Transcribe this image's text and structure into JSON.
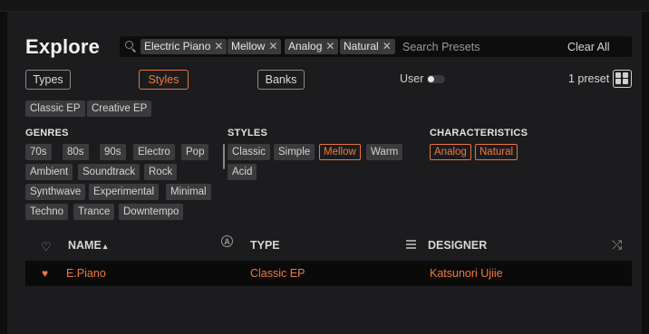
{
  "header": {
    "title": "Explore"
  },
  "search": {
    "chips": [
      {
        "label": "Electric Piano"
      },
      {
        "label": "Mellow"
      },
      {
        "label": "Analog"
      },
      {
        "label": "Natural"
      }
    ],
    "placeholder": "Search Presets",
    "clear_label": "Clear All",
    "remove_glyph": "✕"
  },
  "filters": {
    "tabs": [
      {
        "label": "Types",
        "active": false
      },
      {
        "label": "Styles",
        "active": true
      },
      {
        "label": "Banks",
        "active": false
      }
    ],
    "user_label": "User",
    "user_toggle_on": false,
    "preset_count": "1 preset"
  },
  "type_tags": [
    "Classic EP",
    "Creative EP"
  ],
  "genres": {
    "heading": "GENRES",
    "tags": [
      "70s",
      "80s",
      "90s",
      "Electro",
      "Pop",
      "Ambient",
      "Soundtrack",
      "Rock",
      "Synthwave",
      "Experimental",
      "Minimal",
      "Techno",
      "Trance",
      "Downtempo"
    ]
  },
  "styles": {
    "heading": "STYLES",
    "tags": [
      {
        "label": "Classic",
        "selected": false
      },
      {
        "label": "Simple",
        "selected": false
      },
      {
        "label": "Mellow",
        "selected": true
      },
      {
        "label": "Warm",
        "selected": false
      },
      {
        "label": "Acid",
        "selected": false
      }
    ]
  },
  "characteristics": {
    "heading": "CHARACTERISTICS",
    "tags": [
      {
        "label": "Analog",
        "selected": true
      },
      {
        "label": "Natural",
        "selected": true
      }
    ]
  },
  "table": {
    "columns": {
      "name": "NAME",
      "sort_glyph": "▴",
      "type": "TYPE",
      "designer": "DESIGNER"
    },
    "rows": [
      {
        "favorite": true,
        "name": "E.Piano",
        "type": "Classic EP",
        "designer": "Katsunori Ujiie"
      }
    ]
  },
  "colors": {
    "accent": "#ef7a3e",
    "background": "#1c1c1e",
    "tag_bg": "#3b3b3d"
  },
  "icons": {
    "search": "search-icon",
    "grid": "grid-view-icon",
    "heart": "heart-icon",
    "favorite": "heart-filled-icon",
    "shuffle": "shuffle-icon",
    "list": "list-icon",
    "circled_a": "circled-a-icon"
  }
}
